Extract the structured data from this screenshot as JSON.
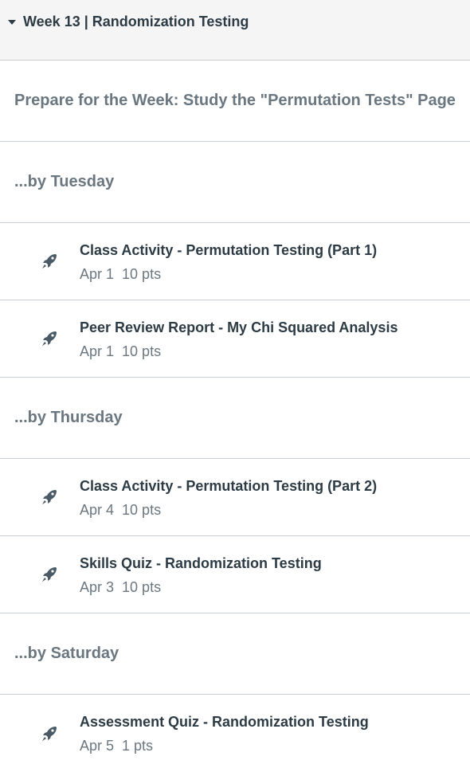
{
  "module": {
    "title": "Week 13 | Randomization Testing"
  },
  "headers": {
    "prepare": "Prepare for the Week: Study the \"Permutation Tests\" Page",
    "tuesday": "...by Tuesday",
    "thursday": "...by Thursday",
    "saturday": "...by Saturday"
  },
  "items": [
    {
      "title": "Class Activity - Permutation Testing (Part 1)",
      "date": "Apr 1",
      "points": "10 pts",
      "icon": "rocket-icon"
    },
    {
      "title": "Peer Review Report - My Chi Squared Analysis",
      "date": "Apr 1",
      "points": "10 pts",
      "icon": "rocket-icon"
    },
    {
      "title": "Class Activity - Permutation Testing (Part 2)",
      "date": "Apr 4",
      "points": "10 pts",
      "icon": "rocket-icon"
    },
    {
      "title": "Skills Quiz - Randomization Testing",
      "date": "Apr 3",
      "points": "10 pts",
      "icon": "rocket-icon"
    },
    {
      "title": "Assessment Quiz - Randomization Testing",
      "date": "Apr 5",
      "points": "1 pts",
      "icon": "rocket-icon"
    }
  ],
  "colors": {
    "header_bg": "#f5f5f5",
    "border": "#c7cdd1",
    "text_dark": "#2d3b45",
    "text_muted": "#6b7780"
  }
}
